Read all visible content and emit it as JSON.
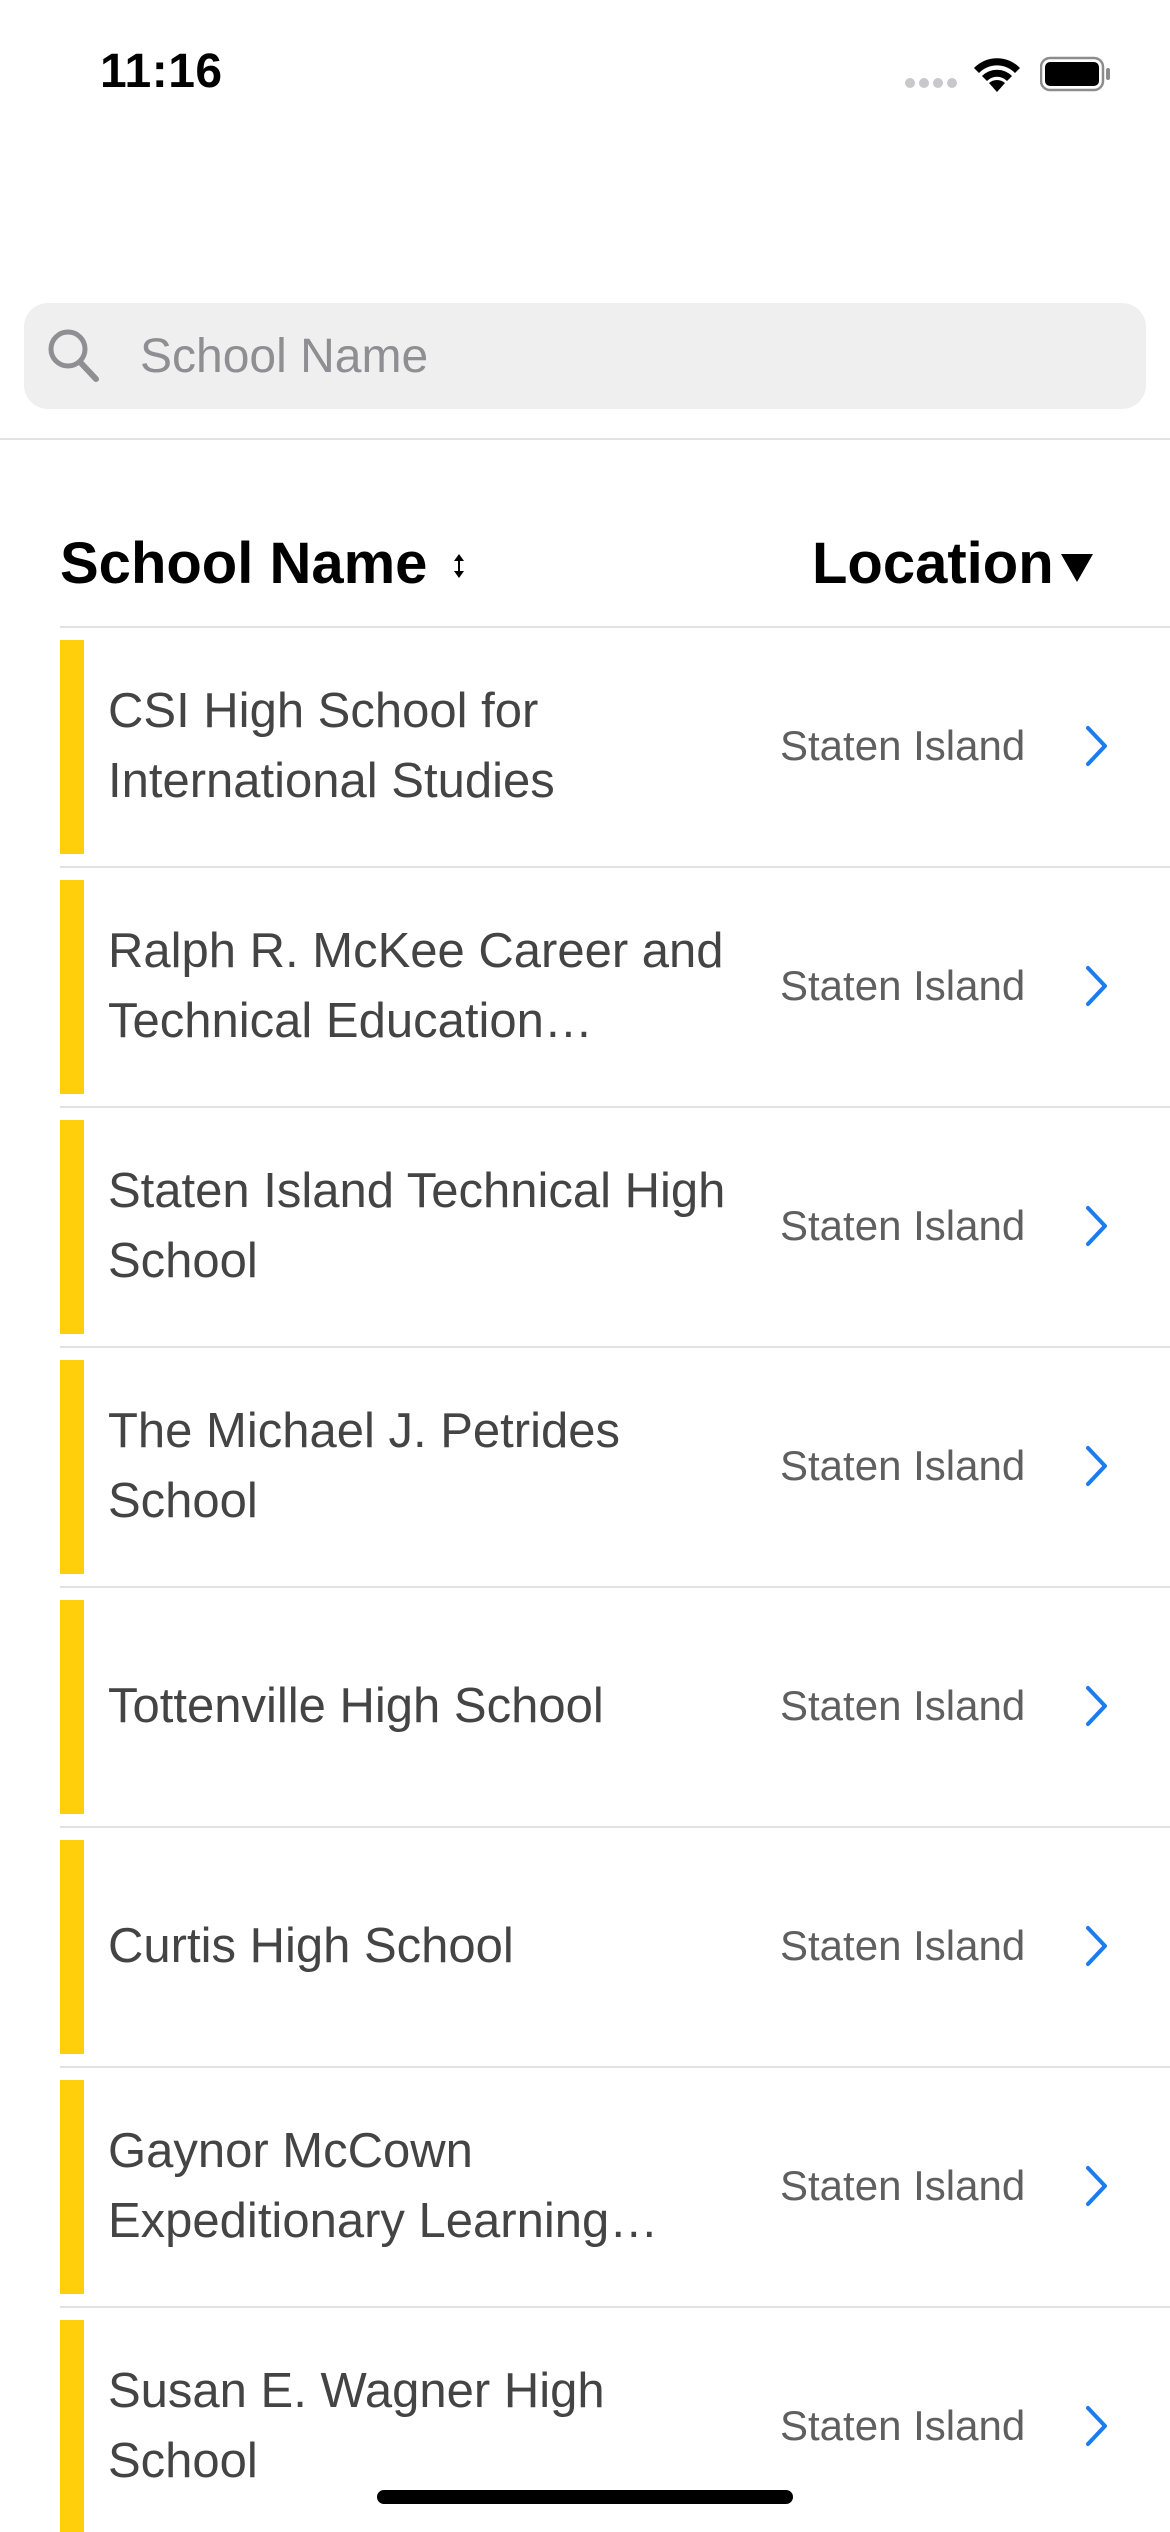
{
  "status_bar": {
    "time": "11:16"
  },
  "search": {
    "placeholder": "School Name",
    "value": ""
  },
  "table": {
    "columns": {
      "name": "School Name",
      "location": "Location"
    },
    "rows": [
      {
        "name": "CSI High School for International Studies",
        "location": "Staten Island"
      },
      {
        "name": "Ralph R. McKee Career and Technical Education…",
        "location": "Staten Island"
      },
      {
        "name": "Staten Island Technical High School",
        "location": "Staten Island"
      },
      {
        "name": "The Michael J. Petrides School",
        "location": "Staten Island"
      },
      {
        "name": "Tottenville High School",
        "location": "Staten Island"
      },
      {
        "name": "Curtis High School",
        "location": "Staten Island"
      },
      {
        "name": "Gaynor McCown Expeditionary Learning…",
        "location": "Staten Island"
      },
      {
        "name": "Susan E. Wagner High School",
        "location": "Staten Island"
      }
    ]
  },
  "colors": {
    "accent": "#fecf0a",
    "chevron": "#1a7cf0",
    "search_bg": "#efefef"
  },
  "icons": {
    "search": "search-icon",
    "sort": "sort-icon",
    "filter": "filter-down-triangle-icon",
    "chevron": "chevron-right-icon"
  }
}
